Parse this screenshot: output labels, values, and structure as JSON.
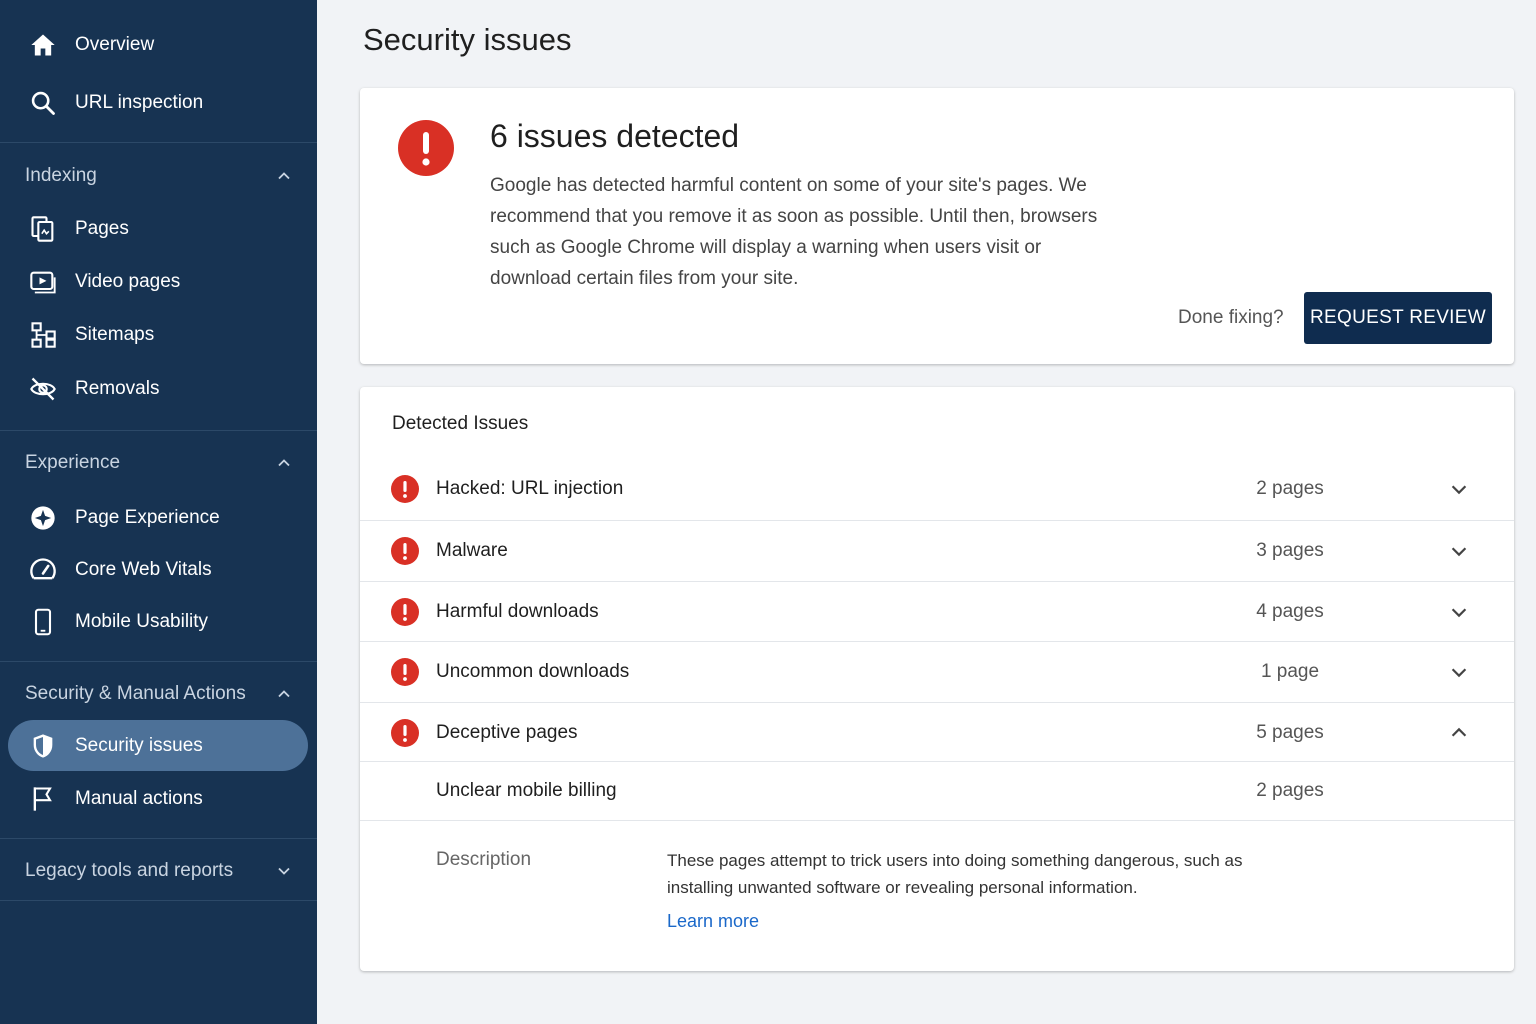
{
  "sidebar": {
    "top_items": [
      {
        "label": "Overview",
        "icon": "home-icon"
      },
      {
        "label": "URL inspection",
        "icon": "search-icon"
      }
    ],
    "sections": {
      "indexing": {
        "label": "Indexing",
        "items": [
          {
            "label": "Pages",
            "icon": "pages-icon"
          },
          {
            "label": "Video pages",
            "icon": "video-icon"
          },
          {
            "label": "Sitemaps",
            "icon": "sitemap-icon"
          },
          {
            "label": "Removals",
            "icon": "eye-off-icon"
          }
        ]
      },
      "experience": {
        "label": "Experience",
        "items": [
          {
            "label": "Page Experience",
            "icon": "star-badge-icon"
          },
          {
            "label": "Core Web Vitals",
            "icon": "gauge-icon"
          },
          {
            "label": "Mobile Usability",
            "icon": "phone-icon"
          }
        ]
      },
      "security": {
        "label": "Security & Manual Actions",
        "items": [
          {
            "label": "Security issues",
            "icon": "shield-icon",
            "active": true
          },
          {
            "label": "Manual actions",
            "icon": "flag-icon"
          }
        ]
      },
      "legacy": {
        "label": "Legacy tools and reports"
      }
    }
  },
  "main": {
    "title": "Security issues",
    "alert": {
      "title": "6 issues detected",
      "description": "Google has detected harmful content on some of your site's pages. We recommend that you remove it as soon as possible. Until then, browsers such as Google Chrome will display a warning when users visit or download certain files from your site.",
      "done_text": "Done fixing?",
      "button_label": "REQUEST REVIEW"
    },
    "issues_card": {
      "heading": "Detected Issues",
      "issues": [
        {
          "name": "Hacked: URL injection",
          "count": "2 pages",
          "expanded": false
        },
        {
          "name": "Malware",
          "count": "3 pages",
          "expanded": false
        },
        {
          "name": "Harmful downloads",
          "count": "4 pages",
          "expanded": false
        },
        {
          "name": "Uncommon downloads",
          "count": "1 page",
          "expanded": false
        },
        {
          "name": "Deceptive pages",
          "count": "5 pages",
          "expanded": true
        }
      ],
      "sub_issue": {
        "name": "Unclear mobile billing",
        "count": "2 pages"
      },
      "detail": {
        "label": "Description",
        "text": "These pages attempt to trick users into doing something dangerous, such as installing unwanted software or revealing personal information.",
        "link": "Learn more"
      }
    }
  },
  "colors": {
    "sidebar_bg": "#173352",
    "active_item": "#4d7198",
    "error_red": "#d93025",
    "button_bg": "#0f2c4f",
    "link": "#1a68c9"
  }
}
